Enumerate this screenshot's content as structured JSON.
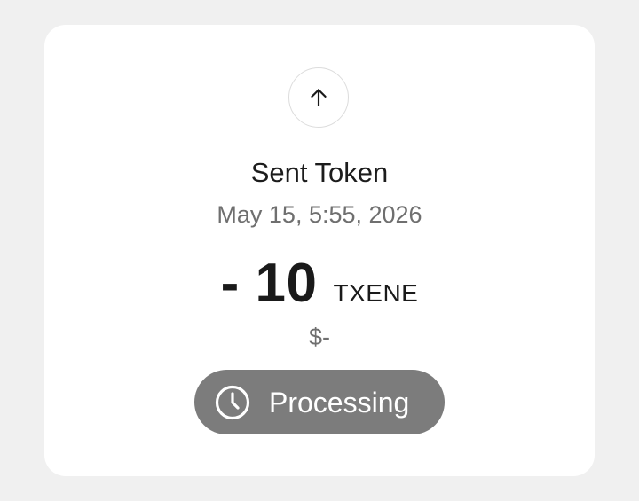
{
  "transaction": {
    "direction_icon": "arrow-up-icon",
    "title": "Sent Token",
    "date": "May 15, 5:55, 2026",
    "amount": "- 10",
    "token_symbol": "TXENE",
    "fiat_value": "$-",
    "status": {
      "icon": "clock-icon",
      "label": "Processing"
    }
  },
  "colors": {
    "page_background": "#f0f0f0",
    "card_background": "#ffffff",
    "primary_text": "#1c1c1c",
    "secondary_text": "#6f6f6f",
    "status_pill": "#7c7c7c",
    "status_text": "#ffffff"
  }
}
